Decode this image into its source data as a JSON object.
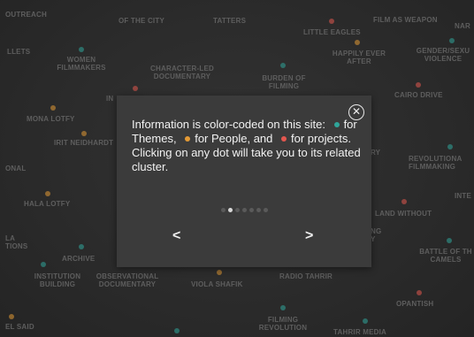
{
  "background": {
    "labels": [
      "OUTREACH",
      "OF THE CITY",
      "TATTERS",
      "FILM AS WEAPON",
      "NAR",
      "LITTLE EAGLES",
      "HAPPILY EVER AFTER",
      "GENDER/SEXU VIOLENCE",
      "LLETS",
      "WOMEN FILMMAKERS",
      "CHARACTER-LED DOCUMENTARY",
      "BURDEN OF FILMING",
      "CAIRO DRIVE",
      "IN",
      "MONA LOTFY",
      "IRIT NEIDHARDT",
      "ONAL",
      "RY",
      "REVOLUTIONA FILMMAKING",
      "HALA LOTFY",
      "INTE",
      "LAND WITHOUT",
      "LA TIONS",
      "NG Y",
      "ARCHIVE",
      "BATTLE OF TH CAMELS",
      "INSTITUTION BUILDING",
      "OBSERVATIONAL DOCUMENTARY",
      "VIOLA SHAFIK",
      "RADIO TAHRIR",
      "OPANTISH",
      "FILMING REVOLUTION",
      "EL SAID",
      "TAHRIR MEDIA"
    ]
  },
  "modal": {
    "close_icon": "close-circle-icon",
    "text_part1": "Information is color-coded on this site:",
    "text_themes": "for Themes,",
    "text_people": "for People, and",
    "text_projects": "for projects. Clicking on any dot will take you to its related cluster.",
    "prev_label": "<",
    "next_label": ">",
    "page_count": 7,
    "active_page": 2,
    "colors": {
      "themes": "#2fa59a",
      "people": "#e49a35",
      "projects": "#e4574f"
    }
  }
}
